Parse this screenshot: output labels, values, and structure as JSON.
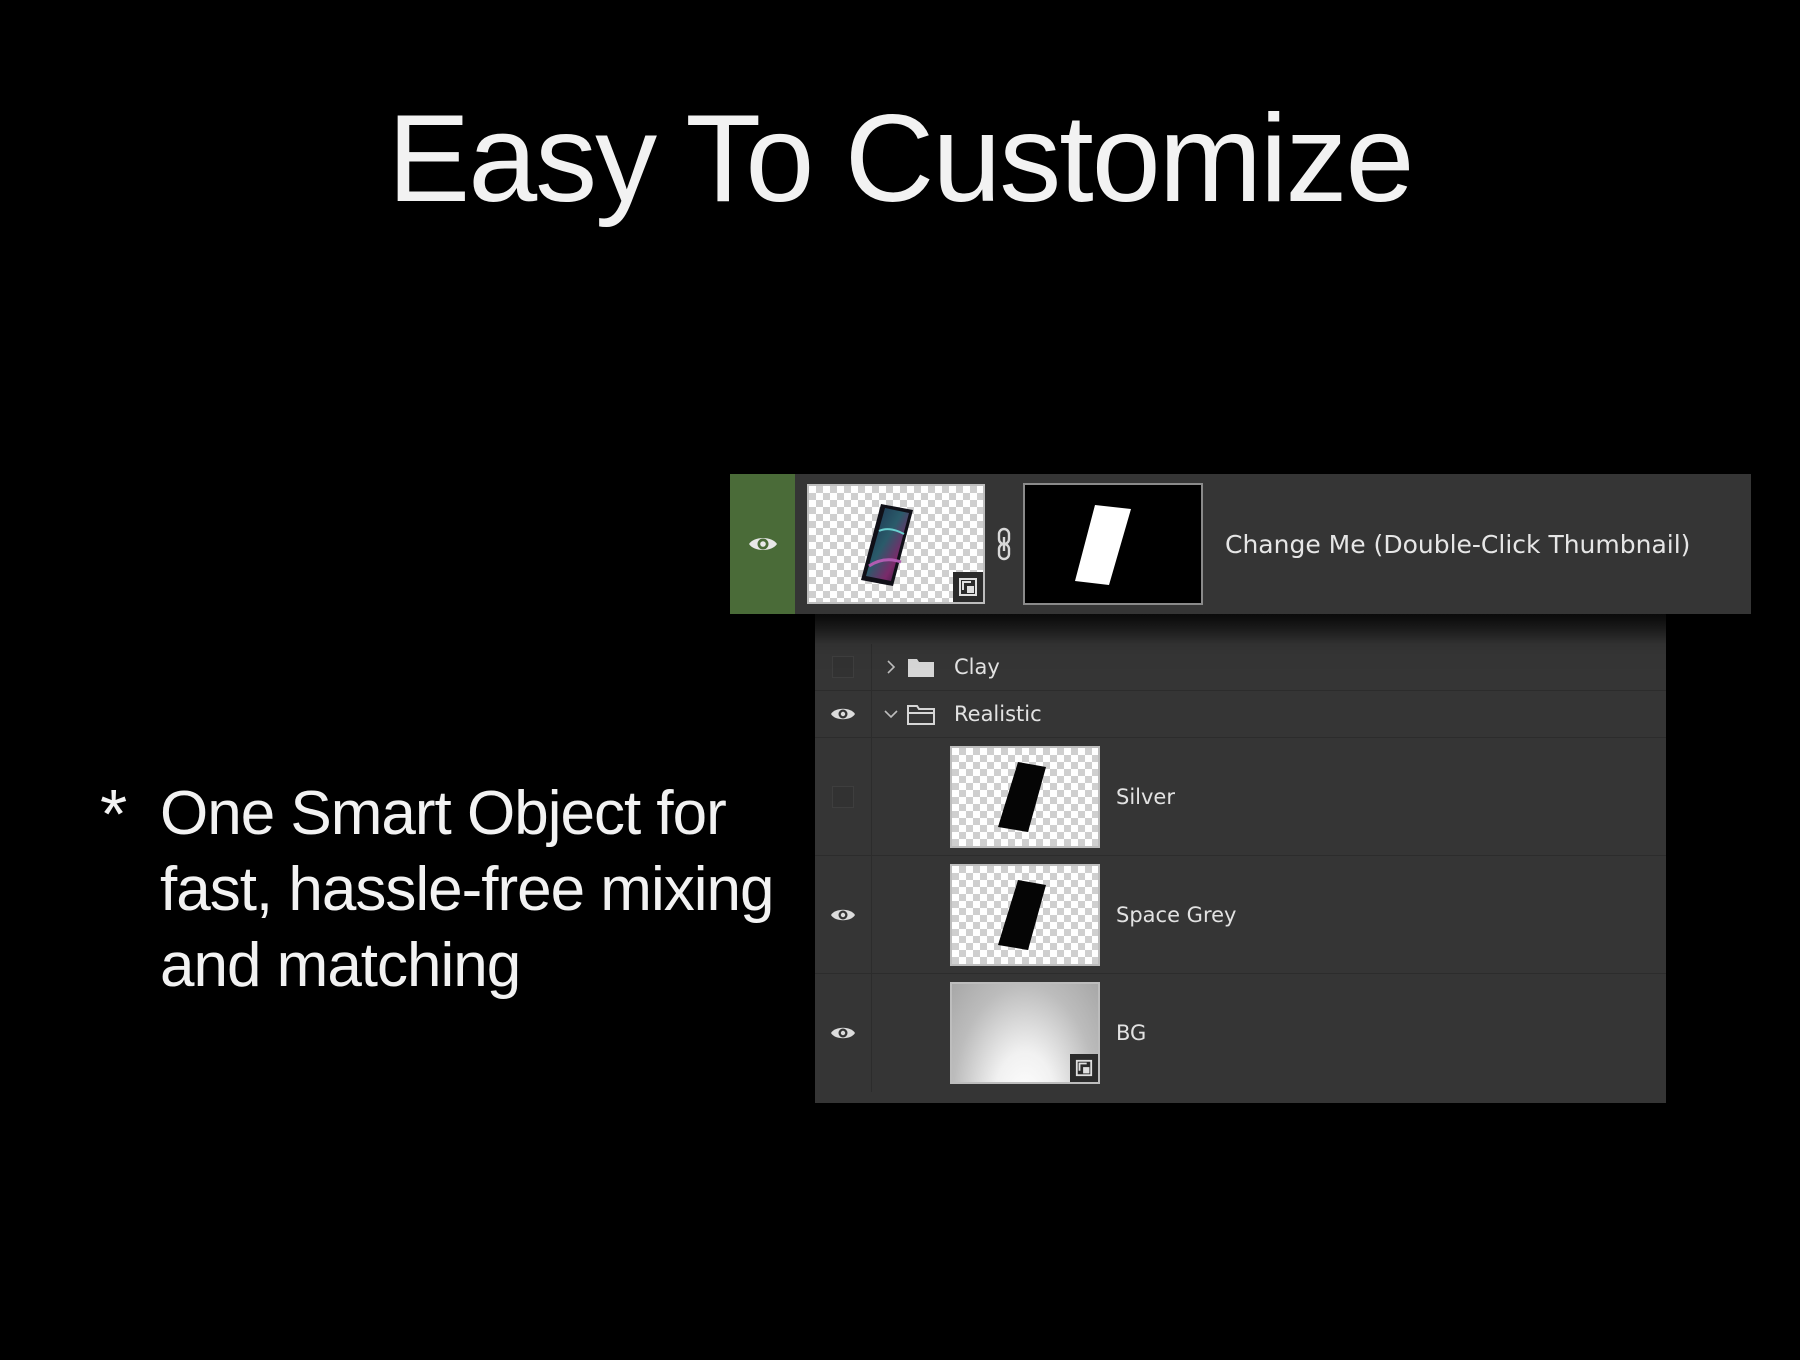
{
  "slide": {
    "title": "Easy To Customize",
    "bullet_marker": "*",
    "bullet_text": "One Smart Object for fast, hassle-free mixing and matching"
  },
  "smart_object_layer": {
    "name": "Change Me (Double-Click Thumbnail)",
    "visible": true,
    "accent_color": "#4a6b38"
  },
  "layers_panel": {
    "groups": [
      {
        "name": "Clay",
        "visible": false,
        "expanded": false
      },
      {
        "name": "Realistic",
        "visible": true,
        "expanded": true
      }
    ],
    "layers": [
      {
        "name": "Silver",
        "visible": false
      },
      {
        "name": "Space Grey",
        "visible": true
      },
      {
        "name": "BG",
        "visible": true
      }
    ]
  },
  "colors": {
    "background": "#000000",
    "panel": "#353535",
    "text": "#f2f2f2"
  }
}
